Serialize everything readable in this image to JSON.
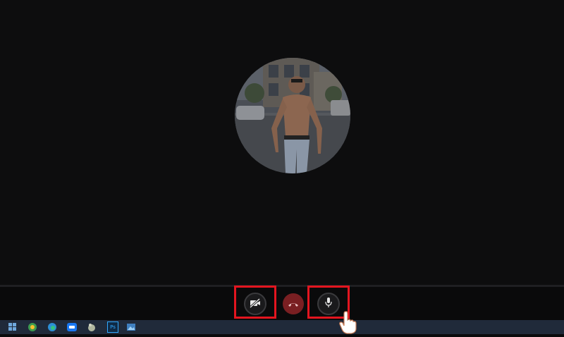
{
  "call": {
    "contact_avatar": "contact-photo"
  },
  "controls": {
    "camera_icon": "video-off-icon",
    "hangup_icon": "phone-hangup-icon",
    "mic_icon": "microphone-icon"
  },
  "taskbar": {
    "items": [
      "start",
      "chrome",
      "edge",
      "zalo",
      "app",
      "photoshop",
      "photos"
    ],
    "photoshop_label": "Ps"
  },
  "colors": {
    "background": "#0d0d0e",
    "highlight": "#e3151f",
    "hangup": "#7a1f22",
    "taskbar": "#202a3a"
  }
}
